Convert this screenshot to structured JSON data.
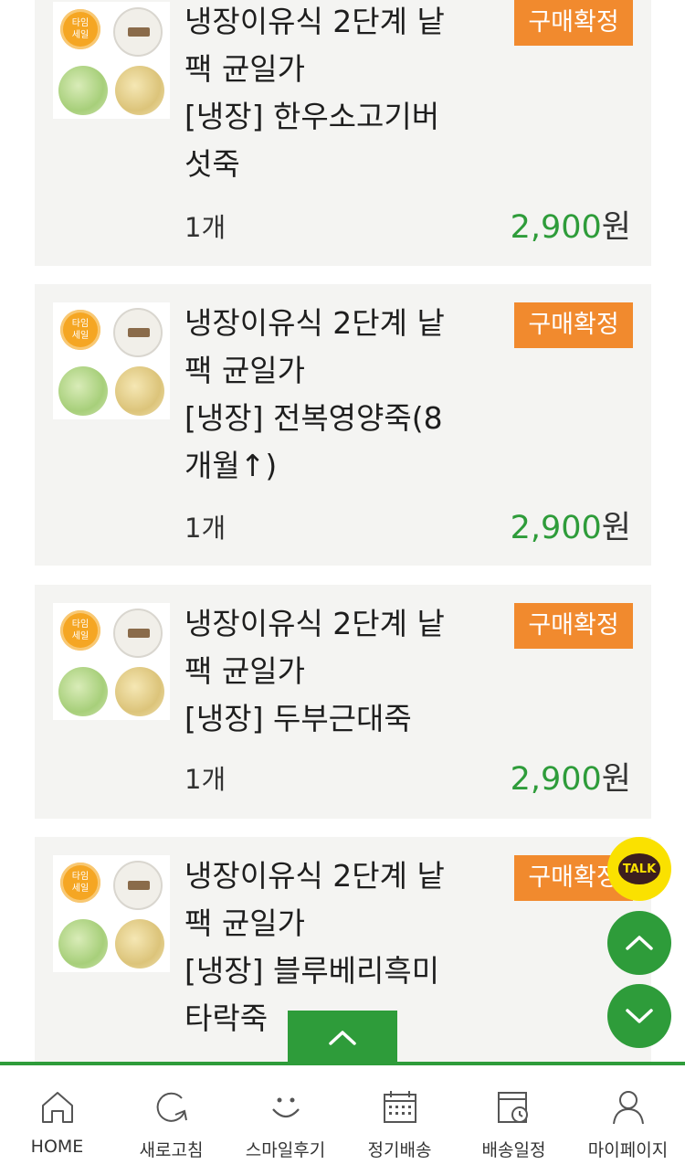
{
  "orders": [
    {
      "title_lines": [
        "냉장이유식 2단계 낱",
        "팩 균일가",
        "[냉장] 한우소고기버",
        "섯죽"
      ],
      "status": "구매확정",
      "qty": "1개",
      "price": "2,900",
      "currency": "원",
      "thumb_badge": "타임\n세일"
    },
    {
      "title_lines": [
        "냉장이유식 2단계 낱",
        "팩 균일가",
        "[냉장] 전복영양죽(8",
        "개월↑)"
      ],
      "status": "구매확정",
      "qty": "1개",
      "price": "2,900",
      "currency": "원",
      "thumb_badge": "타임\n세일"
    },
    {
      "title_lines": [
        "냉장이유식 2단계 낱",
        "팩 균일가",
        "[냉장] 두부근대죽"
      ],
      "status": "구매확정",
      "qty": "1개",
      "price": "2,900",
      "currency": "원",
      "thumb_badge": "타임\n세일"
    },
    {
      "title_lines": [
        "냉장이유식 2단계 낱",
        "팩 균일가",
        "[냉장] 블루베리흑미",
        "타락죽"
      ],
      "status": "구매확정",
      "thumb_badge": "타임\n세일"
    }
  ],
  "floating": {
    "talk_label": "TALK"
  },
  "nav": [
    {
      "label": "HOME",
      "icon": "home-icon"
    },
    {
      "label": "새로고침",
      "icon": "refresh-icon"
    },
    {
      "label": "스마일후기",
      "icon": "smile-icon"
    },
    {
      "label": "정기배송",
      "icon": "calendar-icon"
    },
    {
      "label": "배송일정",
      "icon": "delivery-schedule-icon"
    },
    {
      "label": "마이페이지",
      "icon": "user-icon"
    }
  ],
  "colors": {
    "accent_green": "#2e9c3a",
    "badge_orange": "#f18a2e",
    "card_bg": "#f4f4f2",
    "talk_yellow": "#fae100"
  }
}
